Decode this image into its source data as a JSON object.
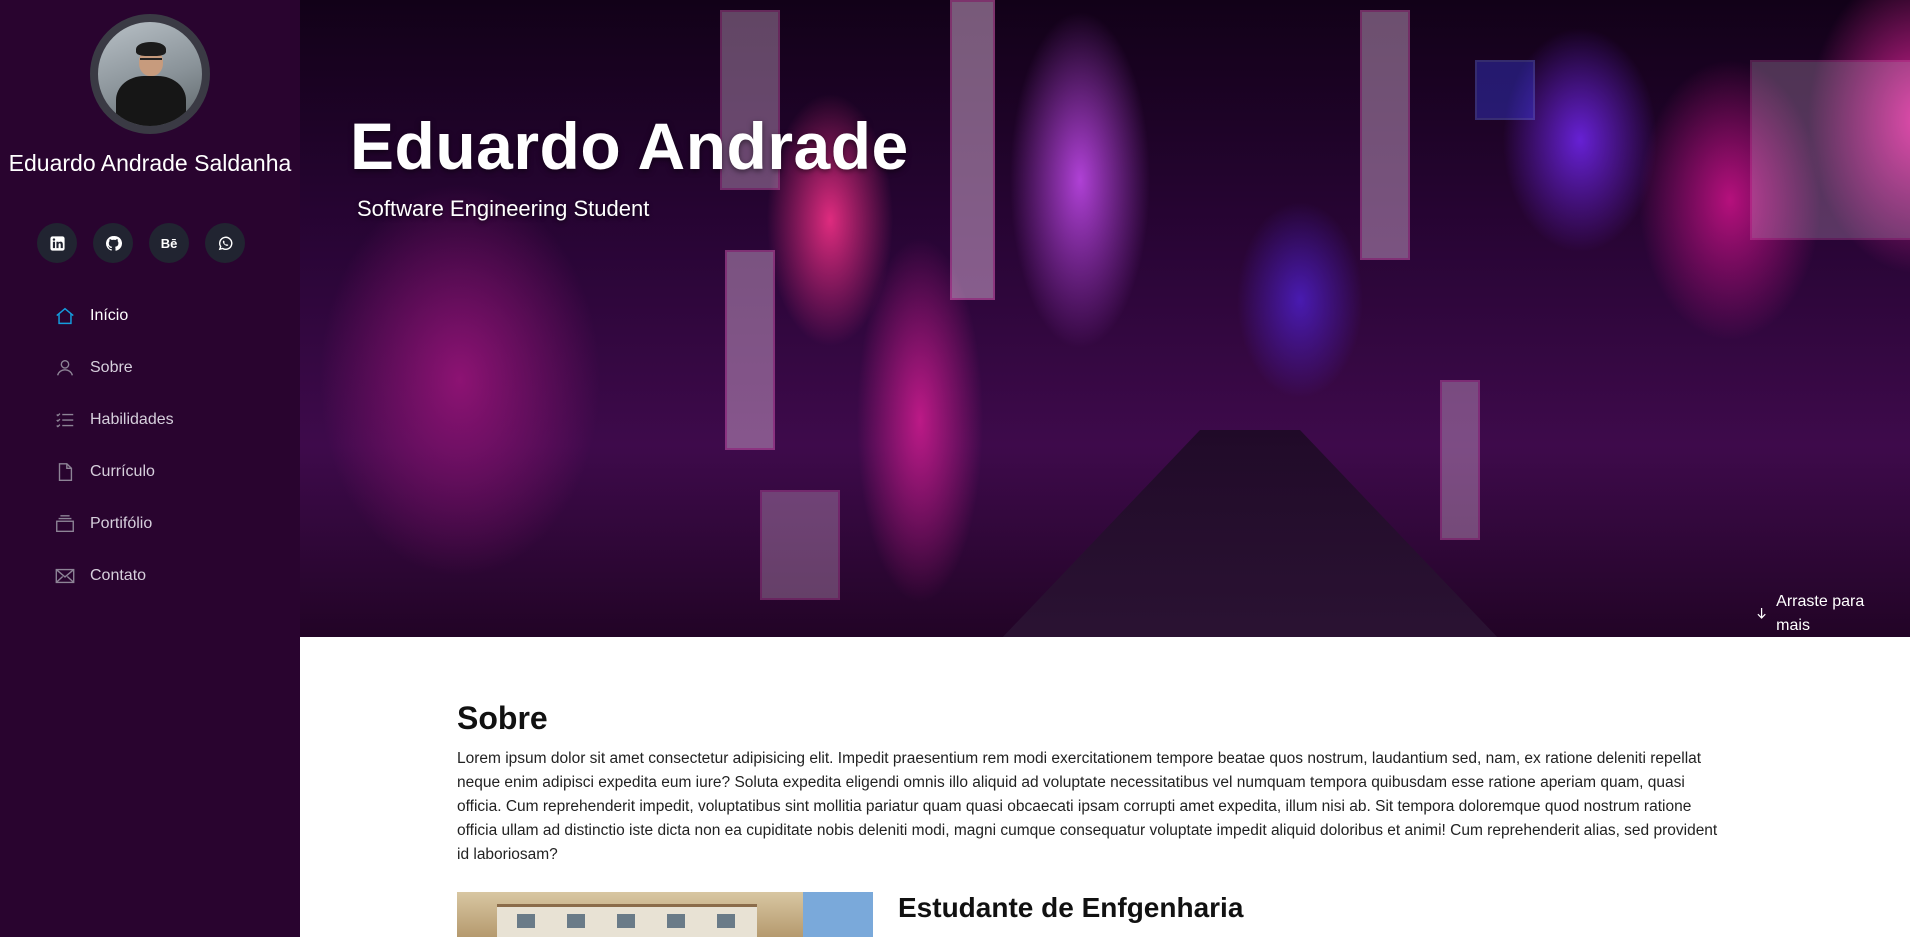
{
  "profile": {
    "name": "Eduardo Andrade Saldanha"
  },
  "socials": [
    {
      "icon": "linkedin-icon"
    },
    {
      "icon": "github-icon"
    },
    {
      "icon": "behance-icon",
      "glyph": "Bē"
    },
    {
      "icon": "whatsapp-icon"
    }
  ],
  "nav": {
    "items": [
      {
        "label": "Início",
        "icon": "home-icon",
        "active": true
      },
      {
        "label": "Sobre",
        "icon": "user-icon"
      },
      {
        "label": "Habilidades",
        "icon": "list-icon"
      },
      {
        "label": "Currículo",
        "icon": "document-icon"
      },
      {
        "label": "Portifólio",
        "icon": "portfolio-icon"
      },
      {
        "label": "Contato",
        "icon": "envelope-icon"
      }
    ]
  },
  "hero": {
    "title": "Eduardo Andrade",
    "subtitle": "Software Engineering Student",
    "scroll_hint": "Arraste para mais"
  },
  "about": {
    "title": "Sobre",
    "text": "Lorem ipsum dolor sit amet consectetur adipisicing elit. Impedit praesentium rem modi exercitationem tempore beatae quos nostrum, laudantium sed, nam, ex ratione deleniti repellat neque enim adipisci expedita eum iure? Soluta expedita eligendi omnis illo aliquid ad voluptate necessitatibus vel numquam tempora quibusdam esse ratione aperiam quam, quasi officia. Cum reprehenderit impedit, voluptatibus sint mollitia pariatur quam quasi obcaecati ipsam corrupti amet expedita, illum nisi ab. Sit tempora doloremque quod nostrum ratione officia ullam ad distinctio iste dicta non ea cupiditate nobis deleniti modi, magni cumque consequatur voluptate impedit aliquid doloribus et animi! Cum reprehenderit alias, sed provident id laboriosam?",
    "subtitle": "Estudante de Enfgenharia"
  },
  "colors": {
    "sidebar_bg": "#29042f",
    "accent": "#149ddd",
    "social_bg": "#212431"
  }
}
